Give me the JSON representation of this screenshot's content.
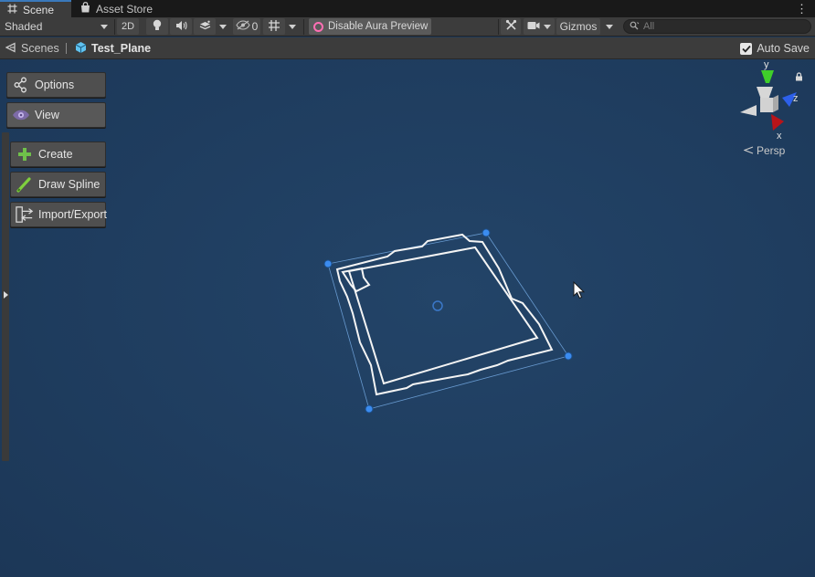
{
  "tabs": [
    {
      "label": "Scene",
      "icon": "hash-grid-icon",
      "active": true
    },
    {
      "label": "Asset Store",
      "icon": "shopping-bag-icon",
      "active": false
    }
  ],
  "toolbar": {
    "shading_mode": "Shaded",
    "mode_2d_label": "2D",
    "hidden_count": "0",
    "aura_button_label": "Disable Aura Preview",
    "gizmos_label": "Gizmos",
    "search_placeholder": "All"
  },
  "breadcrumb": {
    "root_label": "Scenes",
    "scene_label": "Test_Plane"
  },
  "auto_save": {
    "label": "Auto Save",
    "checked": true
  },
  "tool_panel": {
    "options_label": "Options",
    "view_label": "View",
    "create_label": "Create",
    "draw_spline_label": "Draw Spline",
    "import_export_label": "Import/Export"
  },
  "orientation_gizmo": {
    "y_label": "y",
    "z_label": "z",
    "x_label": "x",
    "projection_label": "Persp"
  },
  "colors": {
    "viewport_background": "#1f3d5f",
    "selection_handle": "#3b8cf0",
    "accent_tab": "#3a79bb",
    "aura_ring": "#ff6fb4",
    "axis_x": "#c8161c",
    "axis_y": "#4ecb26",
    "axis_z": "#2a5de8"
  }
}
